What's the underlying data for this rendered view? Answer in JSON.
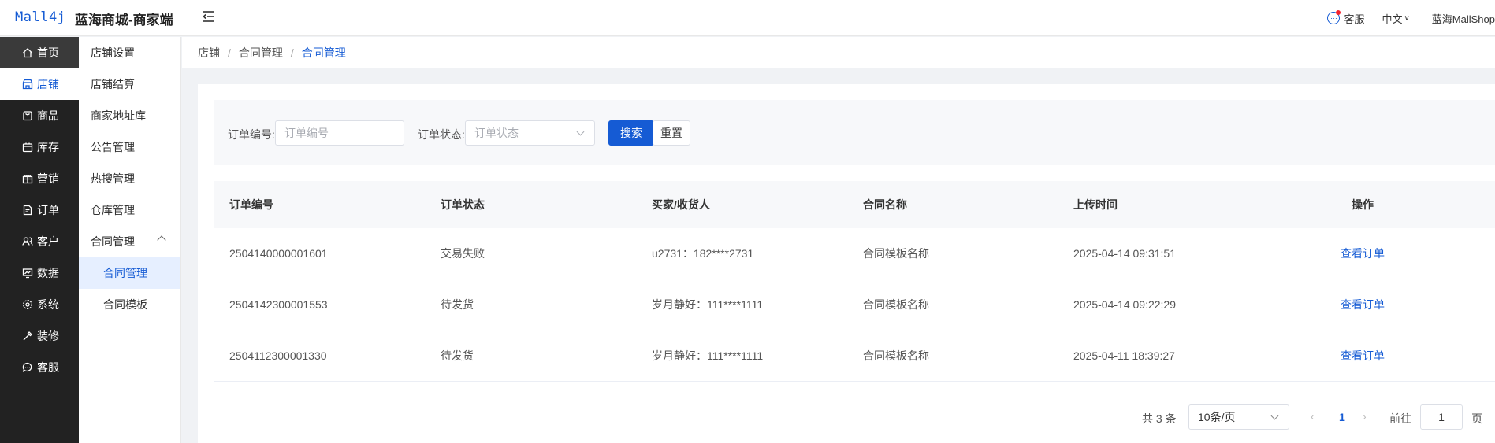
{
  "header": {
    "logo": "Mall4j",
    "app_name": "蓝海商城-商家端",
    "support_label": "客服",
    "language_label": "中文",
    "shop_name": "蓝海MallShop"
  },
  "sidebar": {
    "items": [
      {
        "label": "首页",
        "icon": "home-icon"
      },
      {
        "label": "店铺",
        "icon": "shop-icon"
      },
      {
        "label": "商品",
        "icon": "goods-icon"
      },
      {
        "label": "库存",
        "icon": "inventory-icon"
      },
      {
        "label": "营销",
        "icon": "gift-icon"
      },
      {
        "label": "订单",
        "icon": "order-icon"
      },
      {
        "label": "客户",
        "icon": "customer-icon"
      },
      {
        "label": "数据",
        "icon": "data-icon"
      },
      {
        "label": "系统",
        "icon": "gear-icon"
      },
      {
        "label": "装修",
        "icon": "decorate-icon"
      },
      {
        "label": "客服",
        "icon": "chat-icon"
      }
    ]
  },
  "subnav": {
    "items": [
      "店铺设置",
      "店铺结算",
      "商家地址库",
      "公告管理",
      "热搜管理",
      "仓库管理",
      "合同管理",
      "合同管理",
      "合同模板"
    ]
  },
  "breadcrumb": {
    "items": [
      "店铺",
      "合同管理",
      "合同管理"
    ]
  },
  "search": {
    "order_no_label": "订单编号:",
    "order_no_placeholder": "订单编号",
    "order_no_value": "",
    "status_label": "订单状态:",
    "status_placeholder": "订单状态",
    "search_button": "搜索",
    "reset_button": "重置"
  },
  "table": {
    "columns": [
      "订单编号",
      "订单状态",
      "买家/收货人",
      "合同名称",
      "上传时间",
      "操作"
    ],
    "rows": [
      [
        "2504140000001601",
        "交易失败",
        "u2731：182****2731",
        "合同模板名称",
        "2025-04-14 09:31:51",
        "查看订单"
      ],
      [
        "2504142300001553",
        "待发货",
        "岁月静好：111****1111",
        "合同模板名称",
        "2025-04-14 09:22:29",
        "查看订单"
      ],
      [
        "2504112300001330",
        "待发货",
        "岁月静好：111****1111",
        "合同模板名称",
        "2025-04-11 18:39:27",
        "查看订单"
      ]
    ]
  },
  "pagination": {
    "total": "共 3 条",
    "page_size": "10条/页",
    "current_page": "1",
    "goto_label": "前往",
    "goto_value": "1",
    "page_unit": "页"
  },
  "colors": {
    "accent": "#155bd4",
    "sidebar_bg": "#222222"
  }
}
